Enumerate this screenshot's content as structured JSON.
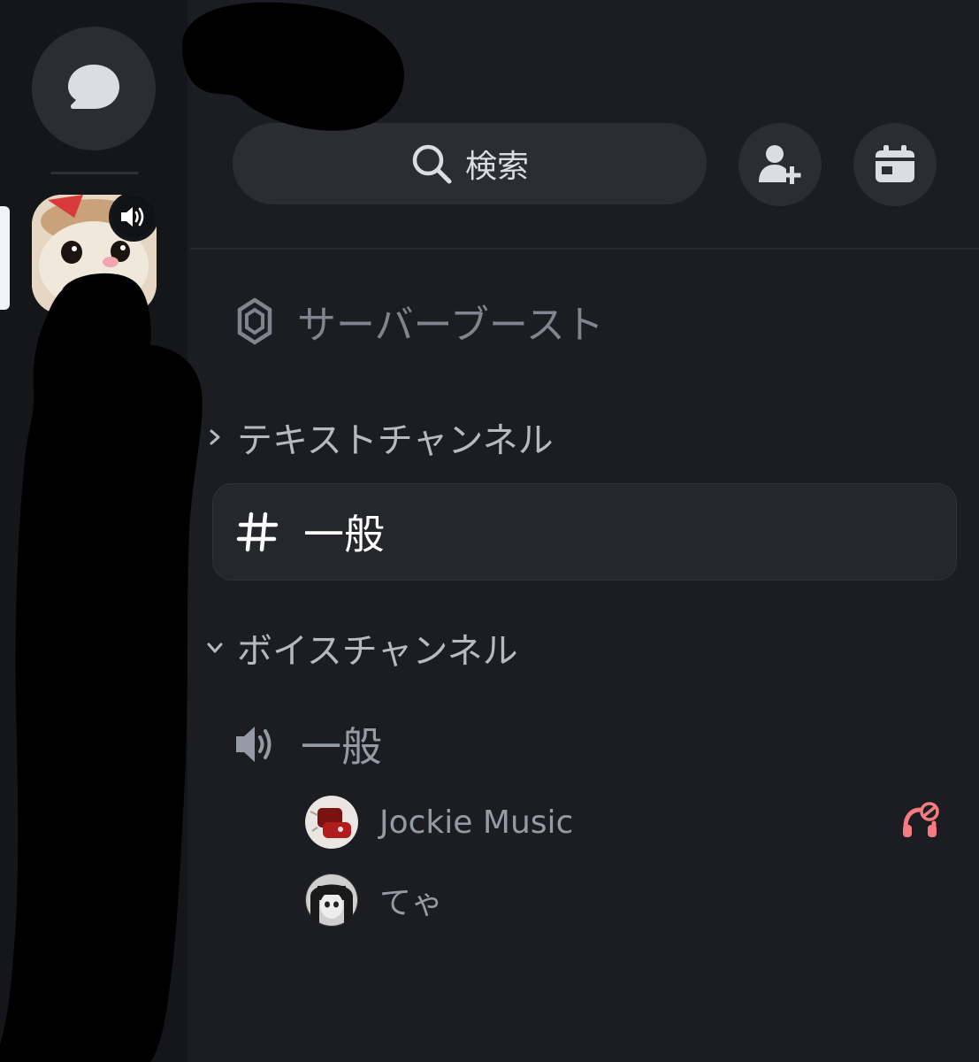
{
  "search": {
    "label": "検索"
  },
  "menu": {
    "server_boost": "サーバーブースト"
  },
  "categories": [
    {
      "label": "テキストチャンネル",
      "expanded": false
    },
    {
      "label": "ボイスチャンネル",
      "expanded": true
    }
  ],
  "text_channels": [
    {
      "name": "一般",
      "selected": true
    }
  ],
  "voice_channels": [
    {
      "name": "一般",
      "members": [
        {
          "name": "Jockie Music",
          "status_icon": "headphones-deafened-icon"
        },
        {
          "name": "てゃ"
        }
      ]
    }
  ],
  "colors": {
    "background": "#1c1d22",
    "rail": "#15161a",
    "surface": "#2b2d31",
    "muted_text": "#949ba4",
    "danger": "#f23f43"
  }
}
